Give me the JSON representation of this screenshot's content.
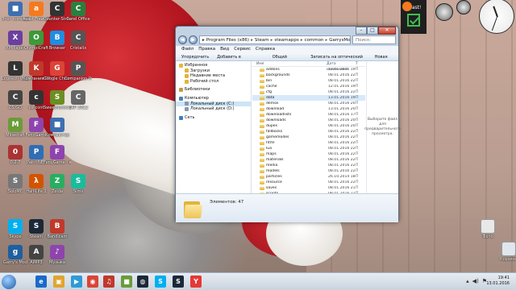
{
  "desktop_icons": [
    {
      "label": "Этот компьютер",
      "color": "#3d6fb1",
      "glyph": "■"
    },
    {
      "label": "Avast Free Antivirus",
      "color": "#f47a1f",
      "glyph": "a"
    },
    {
      "label": "Counter-Strike Source",
      "color": "#333",
      "glyph": "C"
    },
    {
      "label": "Corel Office",
      "color": "#2a7f3f",
      "glyph": "C"
    },
    {
      "label": "XMPlayer",
      "color": "#6a3fa0",
      "glyph": "X"
    },
    {
      "label": "OlympiCraft",
      "color": "#3c9a3a",
      "glyph": "O"
    },
    {
      "label": "Browser",
      "color": "#1f8de0",
      "glyph": "B"
    },
    {
      "label": "Cristalix",
      "color": "#555",
      "glyph": "C"
    },
    {
      "label": "Logitech Webcam",
      "color": "#333",
      "glyph": "L"
    },
    {
      "label": "Компания ГРЧ",
      "color": "#c0392b",
      "glyph": "K"
    },
    {
      "label": "Google Chrome",
      "color": "#db4437",
      "glyph": "G"
    },
    {
      "label": "Companion Pro",
      "color": "#555",
      "glyph": "P"
    },
    {
      "label": "CS:GO",
      "color": "#444",
      "glyph": "C"
    },
    {
      "label": "cs_cont",
      "color": "#333",
      "glyph": "c"
    },
    {
      "label": "SweetHome 3D",
      "color": "#6b8e23",
      "glyph": "S"
    },
    {
      "label": "CRP 2012",
      "color": "#666",
      "glyph": "C"
    },
    {
      "label": "Minecraft",
      "color": "#6b9b3a",
      "glyph": "M"
    },
    {
      "label": "FenyGame",
      "color": "#8e44ad",
      "glyph": "F"
    },
    {
      "label": "Компьютер",
      "color": "#3d6fb1",
      "glyph": "■"
    },
    {
      "label": "0.2.7",
      "color": "#a33",
      "glyph": "0"
    },
    {
      "label": "Paint.NET",
      "color": "#2f6db5",
      "glyph": "P"
    },
    {
      "label": "FenyGame - копия (2)",
      "color": "#8e44ad",
      "glyph": "F"
    },
    {
      "label": "SoloMC",
      "color": "#777",
      "glyph": "S"
    },
    {
      "label": "Half-Life 2",
      "color": "#d35400",
      "glyph": "λ"
    },
    {
      "label": "Zelda",
      "color": "#27ae60",
      "glyph": "Z"
    },
    {
      "label": "Sims",
      "color": "#1abc9c",
      "glyph": "S"
    },
    {
      "label": "Skype",
      "color": "#00aff0",
      "glyph": "S"
    },
    {
      "label": "Steam",
      "color": "#1b2838",
      "glyph": "S"
    },
    {
      "label": "Bandicam",
      "color": "#c0392b",
      "glyph": "B"
    },
    {
      "label": "Garry's Mod",
      "color": "#1f5fa0",
      "glyph": "g"
    },
    {
      "label": "AIMP3",
      "color": "#444",
      "glyph": "A"
    },
    {
      "label": "Музыка",
      "color": "#8e44ad",
      "glyph": "♪"
    }
  ],
  "right_icons": [
    {
      "label": "Фото",
      "color": "#e8e8e8"
    },
    {
      "label": "Корзина",
      "color": "#dfe6ec"
    }
  ],
  "window": {
    "address": [
      "Program Files (x86)",
      "Steam",
      "steamapps",
      "common",
      "GarrysMod",
      "garrysmod"
    ],
    "search_placeholder": "Поиск: garrysmod",
    "menu": [
      "Файл",
      "Правка",
      "Вид",
      "Сервис",
      "Справка"
    ],
    "commands": [
      "Упорядочить ▾",
      "Добавить в библиотеку ▾",
      "Общий доступ ▾",
      "Записать на оптический диск",
      "Новая папка"
    ],
    "nav": [
      {
        "label": "Избранное",
        "type": "star",
        "indent": 0
      },
      {
        "label": "Загрузки",
        "type": "folder",
        "indent": 1
      },
      {
        "label": "Недавние места",
        "type": "folder",
        "indent": 1
      },
      {
        "label": "Рабочий стол",
        "type": "folder",
        "indent": 1
      },
      {
        "label": "",
        "type": "gap",
        "indent": 0
      },
      {
        "label": "Библиотеки",
        "type": "lib",
        "indent": 0
      },
      {
        "label": "",
        "type": "gap",
        "indent": 0
      },
      {
        "label": "Компьютер",
        "type": "pc",
        "indent": 0
      },
      {
        "label": "Локальный диск (C:)",
        "type": "drive",
        "indent": 1,
        "selected": true
      },
      {
        "label": "Локальный диск (D:)",
        "type": "drive",
        "indent": 1
      },
      {
        "label": "",
        "type": "gap",
        "indent": 0
      },
      {
        "label": "Сеть",
        "type": "net",
        "indent": 0
      }
    ],
    "columns": [
      "Имя",
      "Дата изменения",
      "Т"
    ],
    "files": [
      {
        "name": "addons",
        "date": "12.01.2016 19:47",
        "type": "П"
      },
      {
        "name": "backgrounds",
        "date": "08.01.2016 22:46",
        "type": "П"
      },
      {
        "name": "bin",
        "date": "08.01.2016 22:04",
        "type": "П"
      },
      {
        "name": "cache",
        "date": "12.01.2016 19:21",
        "type": "П"
      },
      {
        "name": "cfg",
        "date": "08.01.2016 22:52",
        "type": "П"
      },
      {
        "name": "data",
        "date": "13.01.2016 19:48",
        "type": "П",
        "selected": true
      },
      {
        "name": "demos",
        "date": "08.01.2016 20:26",
        "type": "П"
      },
      {
        "name": "download",
        "date": "13.01.2016 20:09",
        "type": "П"
      },
      {
        "name": "downloadlists",
        "date": "08.01.2016 17:25",
        "type": "П"
      },
      {
        "name": "downloads",
        "date": "08.01.2016 20:49",
        "type": "П"
      },
      {
        "name": "dupes",
        "date": "08.01.2016 20:26",
        "type": "П"
      },
      {
        "name": "fallbacks",
        "date": "08.01.2016 22:06",
        "type": "П"
      },
      {
        "name": "gamemodes",
        "date": "08.01.2016 22:06",
        "type": "П"
      },
      {
        "name": "html",
        "date": "08.01.2016 22:06",
        "type": "П"
      },
      {
        "name": "lua",
        "date": "08.01.2016 22:06",
        "type": "П"
      },
      {
        "name": "maps",
        "date": "08.01.2016 22:46",
        "type": "П"
      },
      {
        "name": "materials",
        "date": "08.01.2016 22:46",
        "type": "П"
      },
      {
        "name": "media",
        "date": "08.01.2016 22:06",
        "type": "П"
      },
      {
        "name": "models",
        "date": "08.01.2016 22:46",
        "type": "П"
      },
      {
        "name": "particles",
        "date": "26.10.2014 18:53",
        "type": "П"
      },
      {
        "name": "resource",
        "date": "08.01.2016 22:46",
        "type": "П"
      },
      {
        "name": "saves",
        "date": "08.01.2016 21:08",
        "type": "П"
      },
      {
        "name": "scripts",
        "date": "08.01.2016 22:06",
        "type": "П"
      }
    ],
    "preview_text": "Выберите файл для предварительного просмотра.",
    "status": "Элементов: 47"
  },
  "widgets": {
    "avast_label": "avast!"
  },
  "taskbar": {
    "apps": [
      {
        "glyph": "e",
        "color": "#1b6ac9"
      },
      {
        "glyph": "▣",
        "color": "#e0a52e"
      },
      {
        "glyph": "▶",
        "color": "#2f9bd6"
      },
      {
        "glyph": "◉",
        "color": "#db4437"
      },
      {
        "glyph": "♫",
        "color": "#c0392b"
      },
      {
        "glyph": "■",
        "color": "#6b9b3a"
      },
      {
        "glyph": "◍",
        "color": "#1b2838"
      },
      {
        "glyph": "S",
        "color": "#00aff0"
      },
      {
        "glyph": "S",
        "color": "#1b2838"
      },
      {
        "glyph": "Y",
        "color": "#e53935"
      }
    ],
    "time": "19:41",
    "date": "13.01.2016"
  }
}
